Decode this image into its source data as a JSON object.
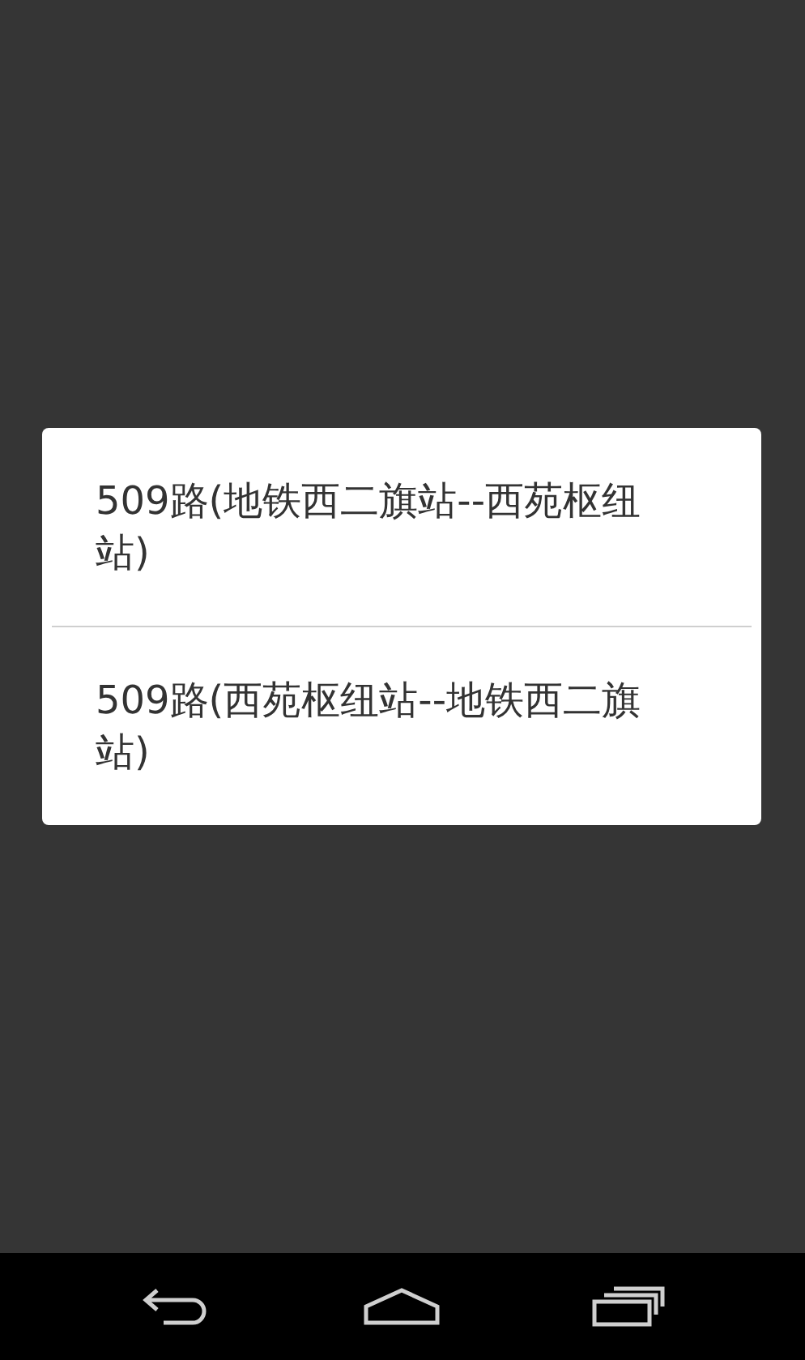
{
  "dialog": {
    "items": [
      {
        "label": "509路(地铁西二旗站--西苑枢纽站)"
      },
      {
        "label": "509路(西苑枢纽站--地铁西二旗站)"
      }
    ]
  }
}
